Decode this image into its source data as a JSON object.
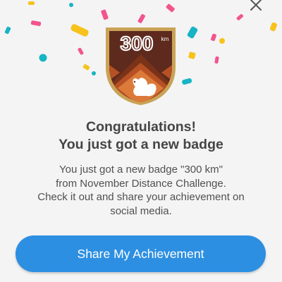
{
  "dialog": {
    "title_line1": "Congratulations!",
    "title_line2": "You just got a new badge",
    "message": "You just got a new badge \"300 km\"\nfrom November Distance Challenge.\nCheck it out and share your achievement on\nsocial media.",
    "share_label": "Share My Achievement"
  },
  "badge": {
    "value": "300",
    "unit": "km",
    "icon": "squirrel-icon",
    "colors": {
      "rim": "#c9a356",
      "top": "#5e2a1e",
      "dark": "#7a3318",
      "mid": "#b55124",
      "light": "#dc7a3a"
    }
  },
  "confetti_colors": [
    "#f2548e",
    "#17b4c5",
    "#f7c21c"
  ],
  "accent_color": "#2d8fe2"
}
